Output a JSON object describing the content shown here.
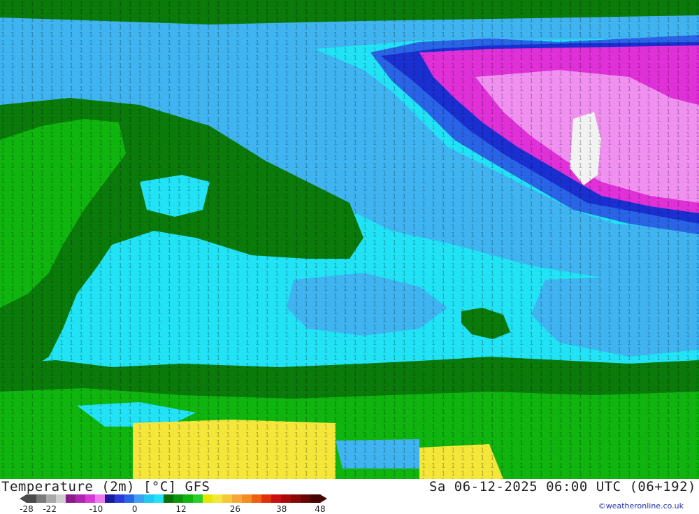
{
  "map": {
    "description_labels": "temperature contour grid",
    "colors": {
      "dark_green": "#0a7a0a",
      "green": "#0fb40f",
      "cyan": "#22e2f5",
      "light_blue": "#3fb4f0",
      "blue": "#2a64e6",
      "dark_blue": "#1a2fd0",
      "violet": "#8a3ef0",
      "pink": "#e030d8",
      "light_pink": "#f090f0",
      "white": "#f2f2f2",
      "yellow": "#f5e63a"
    }
  },
  "footer": {
    "title": "Temperature (2m) [°C] GFS",
    "run_info": "Sa 06-12-2025 06:00 UTC (06+192)",
    "credit": "©weatheronline.co.uk"
  },
  "legend": {
    "colors": [
      "#4a4a4a",
      "#7a7a7a",
      "#a8a8a8",
      "#cfcfcf",
      "#8a1a8a",
      "#b025b0",
      "#d43ad4",
      "#ee7aee",
      "#1a1aa0",
      "#2a3ad8",
      "#2a64e6",
      "#3fa0f0",
      "#22c8f0",
      "#22e2f5",
      "#077007",
      "#0a950a",
      "#0fb40f",
      "#2ad02a",
      "#e6e600",
      "#f5e63a",
      "#f5c83a",
      "#f5a83a",
      "#f58c20",
      "#f06010",
      "#e03010",
      "#c81010",
      "#a80a0a",
      "#880808",
      "#680606",
      "#480404"
    ],
    "ticks": [
      {
        "label": "-28",
        "value": -28
      },
      {
        "label": "-22",
        "value": -22
      },
      {
        "label": "-10",
        "value": -10
      },
      {
        "label": "0",
        "value": 0
      },
      {
        "label": "12",
        "value": 12
      },
      {
        "label": "26",
        "value": 26
      },
      {
        "label": "38",
        "value": 38
      },
      {
        "label": "48",
        "value": 48
      }
    ]
  }
}
